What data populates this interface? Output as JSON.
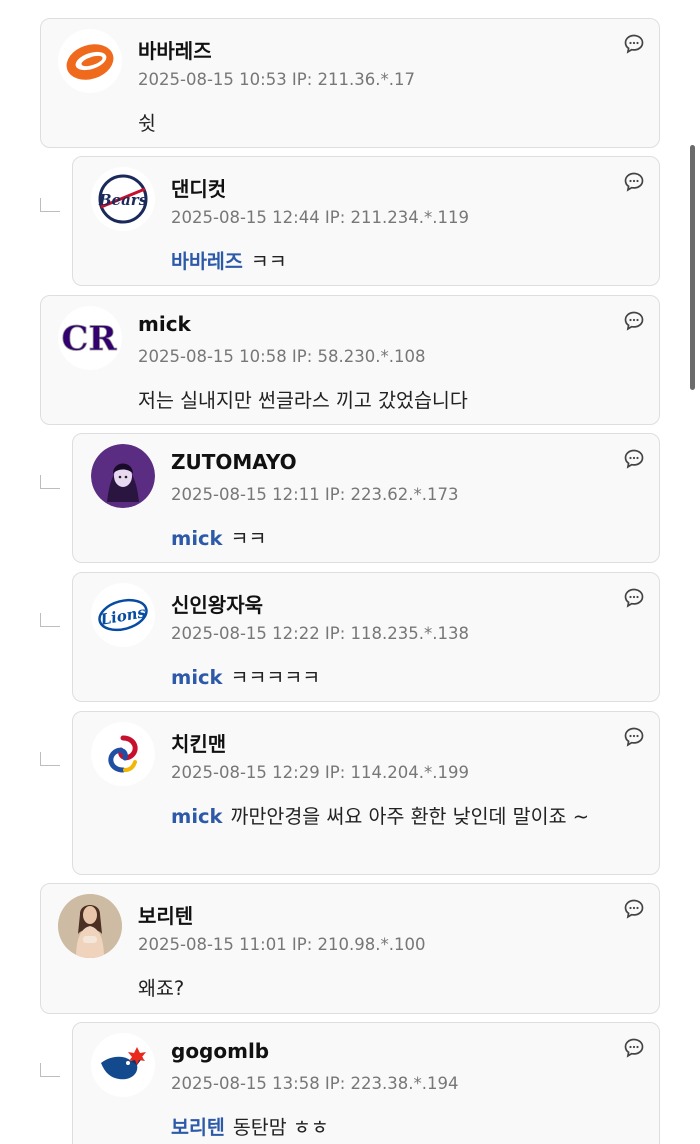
{
  "comments": [
    {
      "nick": "바바레즈",
      "meta": "2025-08-15 10:53  IP: 211.36.*.17",
      "mention": "",
      "text": "쉿",
      "avatar_icon": "orange-circle-logo-icon"
    },
    {
      "nick": "댄디컷",
      "meta": "2025-08-15 12:44  IP: 211.234.*.119",
      "mention": "바바레즈",
      "text": "ㅋㅋ",
      "avatar_icon": "bears-logo-icon"
    },
    {
      "nick": "mick",
      "meta": "2025-08-15 10:58  IP: 58.230.*.108",
      "mention": "",
      "text": "저는 실내지만 썬글라스 끼고 갔었습니다",
      "avatar_icon": "cr-logo-icon"
    },
    {
      "nick": "ZUTOMAYO",
      "meta": "2025-08-15 12:11  IP: 223.62.*.173",
      "mention": "mick",
      "text": "ㅋㅋ",
      "avatar_icon": "purple-character-avatar-icon"
    },
    {
      "nick": "신인왕자욱",
      "meta": "2025-08-15 12:22  IP: 118.235.*.138",
      "mention": "mick",
      "text": "ㅋㅋㅋㅋㅋ",
      "avatar_icon": "lions-logo-icon"
    },
    {
      "nick": "치킨맨",
      "meta": "2025-08-15 12:29  IP: 114.204.*.199",
      "mention": "mick",
      "text": "까만안경을 써요 아주 환한 낮인데 말이죠 ~",
      "avatar_icon": "swirl-logo-icon"
    },
    {
      "nick": "보리텐",
      "meta": "2025-08-15 11:01  IP: 210.98.*.100",
      "mention": "",
      "text": "왜죠?",
      "avatar_icon": "person-photo-avatar-icon"
    },
    {
      "nick": "gogomlb",
      "meta": "2025-08-15 13:58  IP: 223.38.*.194",
      "mention": "보리텐",
      "text": "동탄맘 ㅎㅎ",
      "avatar_icon": "blue-jays-logo-icon"
    }
  ],
  "reply_button_icon": "speech-bubble-icon",
  "colors": {
    "mention": "#2d5aa8",
    "card_bg": "#f9f9f9",
    "card_border": "#dedede",
    "meta": "#777777"
  }
}
